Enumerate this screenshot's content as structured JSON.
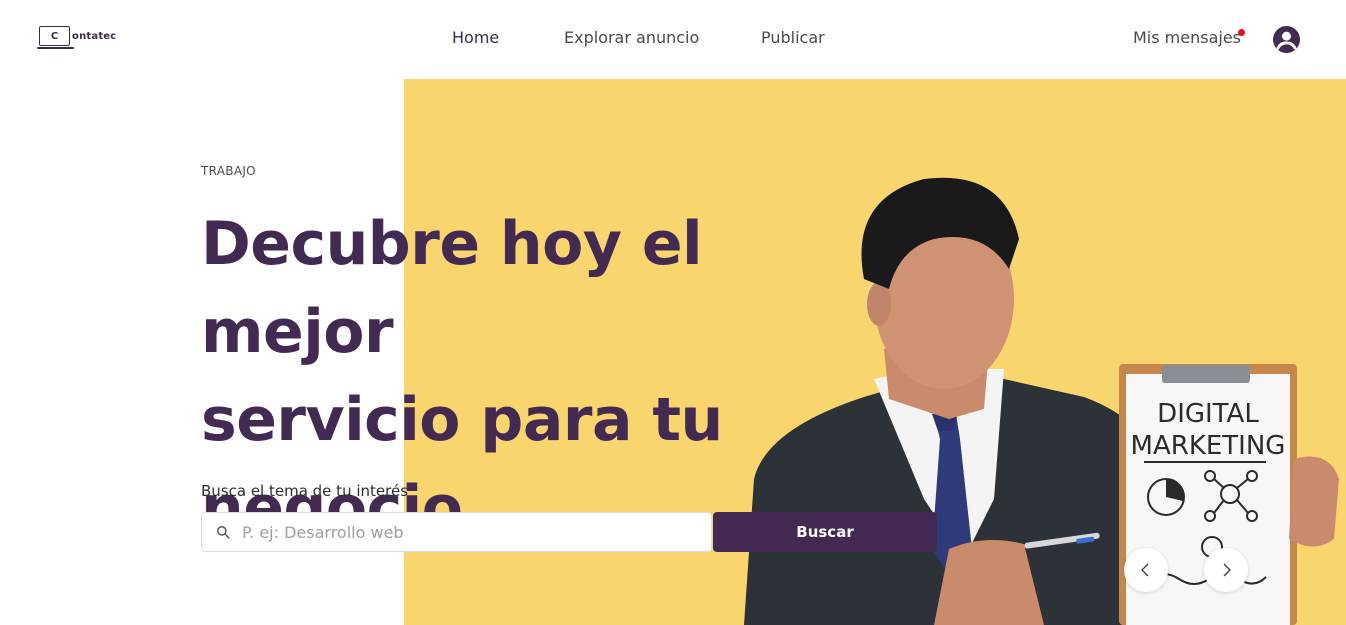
{
  "header": {
    "logo": {
      "mark_letter": "C",
      "text": "ontatec"
    },
    "nav": {
      "home": "Home",
      "explore": "Explorar anuncio",
      "publish": "Publicar"
    },
    "messages_label": "Mis mensajes",
    "icons": {
      "notification": "notification-dot",
      "user": "user-circle-icon"
    }
  },
  "hero": {
    "eyebrow": "TRABAJO",
    "headline_line1": "Decubre hoy el mejor",
    "headline_line2": "servicio para tu",
    "headline_line3": "negocio",
    "search_label": "Busca el tema de tu interés",
    "search_placeholder": "P. ej: Desarrollo web",
    "search_value": "",
    "search_button": "Buscar",
    "image_board": {
      "line1": "DIGITAL",
      "line2": "MARKETING"
    },
    "carousel": {
      "prev_icon": "chevron-left-icon",
      "next_icon": "chevron-right-icon"
    }
  },
  "colors": {
    "brand": "#432a52",
    "hero_background": "#f9d56e",
    "notification": "#e3121b"
  }
}
